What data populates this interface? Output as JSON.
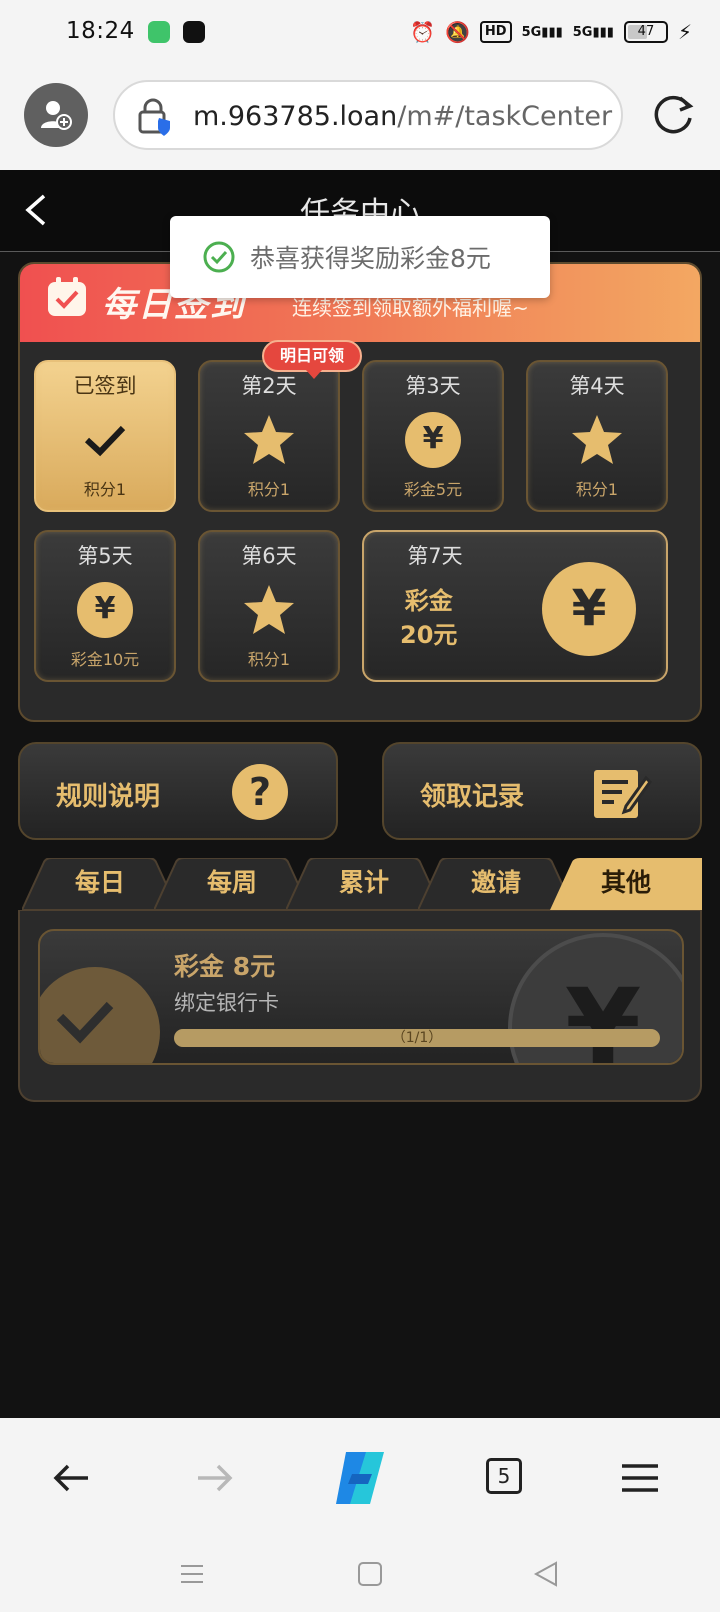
{
  "status_bar": {
    "time": "18:24",
    "hd_label": "HD",
    "signal1_label": "5G",
    "signal2_label": "5G",
    "battery": "47",
    "battery_level": 0.47
  },
  "browser": {
    "url_host": "m.963785.loan",
    "url_path": "/m#/taskCenter",
    "tab_count": "5"
  },
  "header": {
    "title": "任务中心"
  },
  "toast": {
    "message": "恭喜获得奖励彩金8元"
  },
  "checkin": {
    "banner_title": "每日签到",
    "banner_subtitle": "连续签到领取额外福利喔~",
    "tomorrow_badge": "明日可领",
    "days": [
      {
        "label": "已签到",
        "reward": "积分1",
        "icon": "check-icon"
      },
      {
        "label": "第2天",
        "reward": "积分1",
        "icon": "star-icon"
      },
      {
        "label": "第3天",
        "reward": "彩金5元",
        "icon": "yen-coin-icon"
      },
      {
        "label": "第4天",
        "reward": "积分1",
        "icon": "star-icon"
      },
      {
        "label": "第5天",
        "reward": "彩金10元",
        "icon": "yen-coin-icon"
      },
      {
        "label": "第6天",
        "reward": "积分1",
        "icon": "star-icon"
      },
      {
        "label": "第7天",
        "reward_line1": "彩金",
        "reward_line2": "20元",
        "icon": "yen-coin-icon"
      }
    ],
    "yen_symbol": "¥"
  },
  "actions": {
    "rules_label": "规则说明",
    "help_glyph": "?",
    "records_label": "领取记录"
  },
  "tabs": [
    "每日",
    "每周",
    "累计",
    "邀请",
    "其他"
  ],
  "active_tab": "其他",
  "task": {
    "reward": "彩金 8元",
    "description": "绑定银行卡",
    "progress_text": "（1/1）",
    "progress_fraction": 1.0
  },
  "colors": {
    "gold": "#e6bd6e",
    "banner_start": "#f05050",
    "banner_end": "#f3a862",
    "badge_red": "#e5473e",
    "toast_check": "#4caf50"
  }
}
